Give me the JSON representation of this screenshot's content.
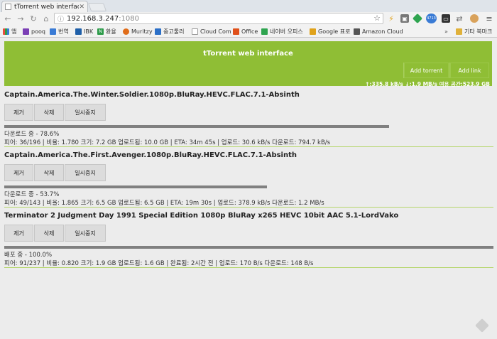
{
  "browser": {
    "tab_title": "tTorrent web interface",
    "url_host": "192.168.3.247",
    "url_port": ":1080",
    "ext_badge": "4713"
  },
  "bookmarks": [
    {
      "label": "앱",
      "color": "#e74c3c"
    },
    {
      "label": "pooq",
      "color": "#7b3fb5"
    },
    {
      "label": "번역",
      "color": "#3a7bd5"
    },
    {
      "label": "IBK",
      "color": "#1f5fa8"
    },
    {
      "label": "환율",
      "color": "#2d9b4a"
    },
    {
      "label": "Muritzy",
      "color": "#e06d1a"
    },
    {
      "label": "중고툴러",
      "color": "#2b6fc7"
    },
    {
      "label": "Cloud Com",
      "color": "#999999"
    },
    {
      "label": "Office",
      "color": "#e0501a"
    },
    {
      "label": "네이버 오피스",
      "color": "#2ea44f"
    },
    {
      "label": "Google 표로",
      "color": "#e0a21a"
    },
    {
      "label": "Amazon Cloud",
      "color": "#555555"
    },
    {
      "label": "기타 북마크",
      "color": "#e0b13a"
    }
  ],
  "header": {
    "title": "tTorrent web interface",
    "add_torrent": "Add torrent",
    "add_link": "Add link",
    "speeds": "↑:335.8 kB/s ↓:1.9 MB/s 여유 공간:523.9 GB"
  },
  "buttons": {
    "remove": "제거",
    "delete": "삭제",
    "pause": "일시중지"
  },
  "torrents": [
    {
      "name": "Captain.America.The.Winter.Soldier.1080p.BluRay.HEVC.FLAC.7.1-Absinth",
      "progress": 0.786,
      "status": "다운로드 중 - 78.6%",
      "stats": "피어: 36/196 | 비율: 1.780 크기: 7.2 GB 업로드됨: 10.0 GB | ETA: 34m 45s | 업로드: 30.6 kB/s 다운로드: 794.7 kB/s"
    },
    {
      "name": "Captain.America.The.First.Avenger.1080p.BluRay.HEVC.FLAC.7.1-Absinth",
      "progress": 0.537,
      "status": "다운로드 중 - 53.7%",
      "stats": "피어: 49/143 | 비율: 1.865 크기: 6.5 GB 업로드됨: 6.5 GB | ETA: 19m 30s | 업로드: 378.9 kB/s 다운로드: 1.2 MB/s"
    },
    {
      "name": "Terminator 2 Judgment Day 1991 Special Edition 1080p BluRay x265 HEVC 10bit AAC 5.1-LordVako",
      "progress": 1.0,
      "status": "배포 중 - 100.0%",
      "stats": "피어: 91/237 | 비율: 0.820 크기: 1.9 GB 업로드됨: 1.6 GB | 완료됨: 2시간 전 | 업로드: 170 B/s 다운로드: 148 B/s"
    }
  ]
}
